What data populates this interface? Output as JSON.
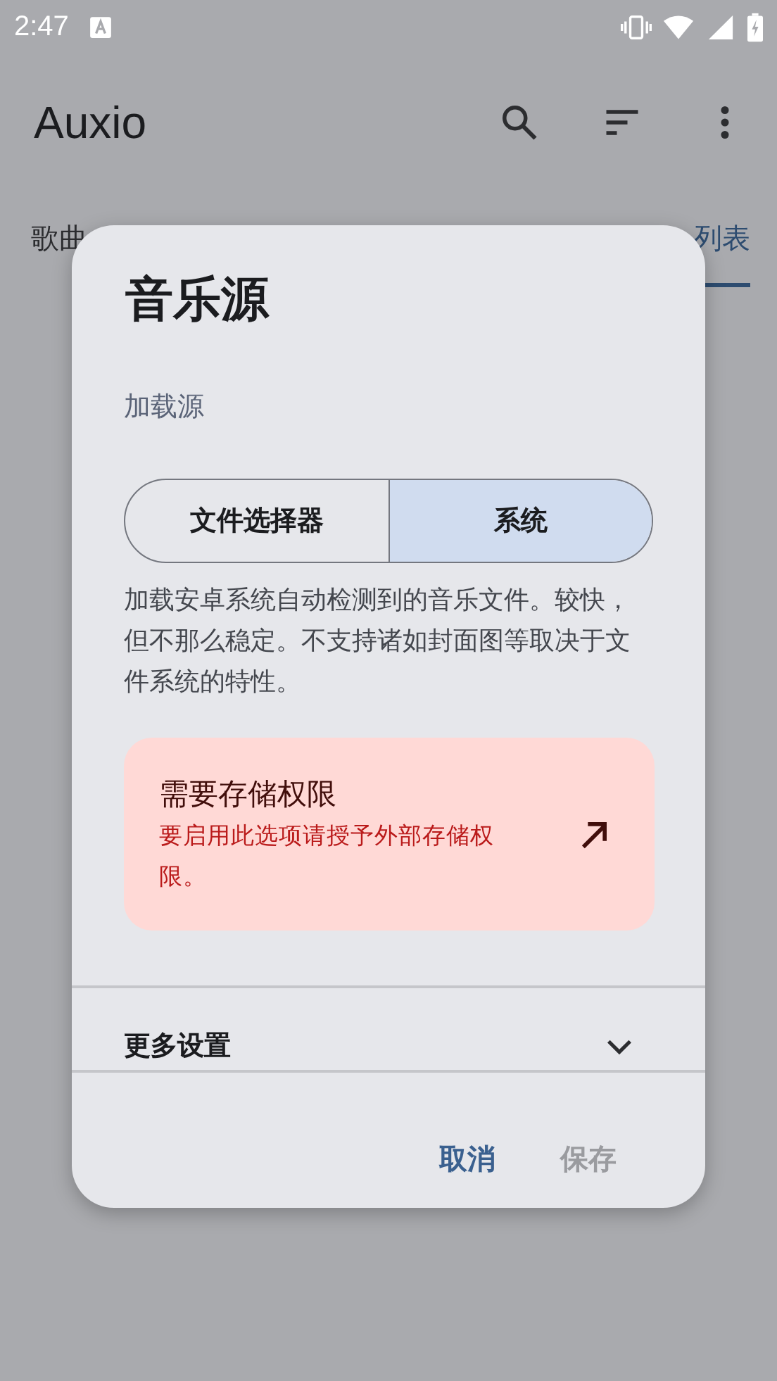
{
  "status_bar": {
    "time": "2:47"
  },
  "app_bar": {
    "title": "Auxio"
  },
  "tabs": [
    {
      "label": "歌曲",
      "selected": false
    },
    {
      "label": "列表",
      "selected": true
    }
  ],
  "dialog": {
    "title": "音乐源",
    "section": "加载源",
    "segments": [
      {
        "label": "文件选择器",
        "selected": false
      },
      {
        "label": "系统",
        "selected": true
      }
    ],
    "description": "加载安卓系统自动检测到的音乐文件。较快，但不那么稳定。不支持诸如封面图等取决于文件系统的特性。",
    "notice": {
      "title": "需要存储权限",
      "message": "要启用此选项请授予外部存储权限。"
    },
    "more": {
      "label": "更多设置",
      "expanded": false
    },
    "buttons": [
      {
        "label": "取消",
        "disabled": false
      },
      {
        "label": "保存",
        "disabled": true
      }
    ]
  }
}
